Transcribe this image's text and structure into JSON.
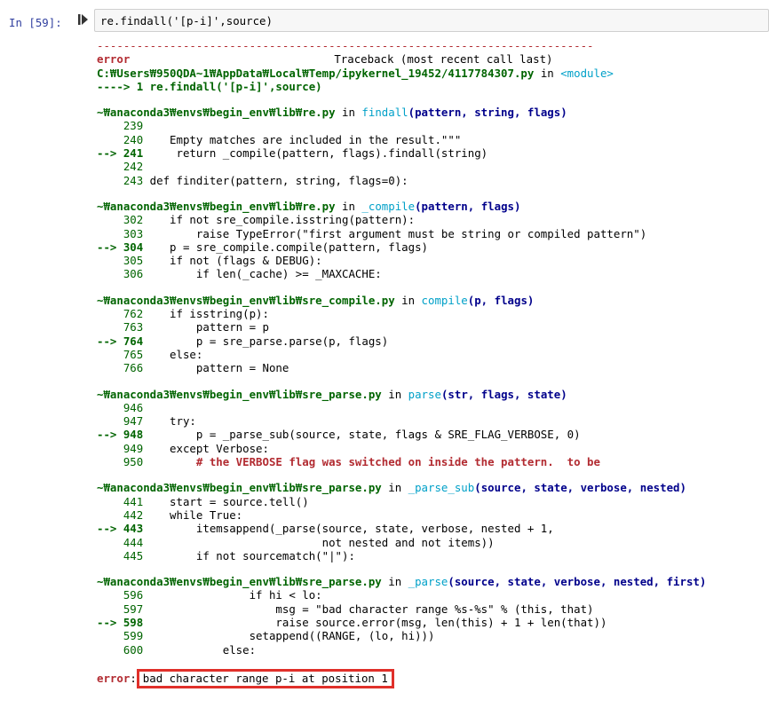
{
  "cell": {
    "prompt": "In [59]:",
    "code": "re.findall('[p-i]',source)"
  },
  "traceback": {
    "separator": "---------------------------------------------------------------------------",
    "error_name": "error",
    "header_right": "Traceback (most recent call last)",
    "frame0_path": "C:₩Users₩950QDA~1₩AppData₩Local₩Temp/ipykernel_19452/4117784307.py",
    "frame0_in": " in ",
    "frame0_module": "<module>",
    "frame0_line": "----> 1 re.findall('[p-i]',source)",
    "frames": [
      {
        "path": "~₩anaconda3₩envs₩begin_env₩lib₩re.py",
        "func": "findall",
        "sig": "(pattern, string, flags)",
        "lines": [
          {
            "no": "    239",
            "code": ""
          },
          {
            "no": "    240",
            "code": "    Empty matches are included in the result.\"\"\""
          },
          {
            "no": "--> 241",
            "code": "     return _compile(pattern, flags).findall(string)",
            "current": true
          },
          {
            "no": "    242",
            "code": ""
          },
          {
            "no": "    243",
            "code": " def finditer(pattern, string, flags=0):"
          }
        ]
      },
      {
        "path": "~₩anaconda3₩envs₩begin_env₩lib₩re.py",
        "func": "_compile",
        "sig": "(pattern, flags)",
        "lines": [
          {
            "no": "    302",
            "code": "    if not sre_compile.isstring(pattern):"
          },
          {
            "no": "    303",
            "code": "        raise TypeError(\"first argument must be string or compiled pattern\")"
          },
          {
            "no": "--> 304",
            "code": "    p = sre_compile.compile(pattern, flags)",
            "current": true
          },
          {
            "no": "    305",
            "code": "    if not (flags & DEBUG):"
          },
          {
            "no": "    306",
            "code": "        if len(_cache) >= _MAXCACHE:"
          }
        ]
      },
      {
        "path": "~₩anaconda3₩envs₩begin_env₩lib₩sre_compile.py",
        "func": "compile",
        "sig": "(p, flags)",
        "lines": [
          {
            "no": "    762",
            "code": "    if isstring(p):"
          },
          {
            "no": "    763",
            "code": "        pattern = p"
          },
          {
            "no": "--> 764",
            "code": "        p = sre_parse.parse(p, flags)",
            "current": true
          },
          {
            "no": "    765",
            "code": "    else:"
          },
          {
            "no": "    766",
            "code": "        pattern = None"
          }
        ]
      },
      {
        "path": "~₩anaconda3₩envs₩begin_env₩lib₩sre_parse.py",
        "func": "parse",
        "sig": "(str, flags, state)",
        "lines": [
          {
            "no": "    946",
            "code": ""
          },
          {
            "no": "    947",
            "code": "    try:"
          },
          {
            "no": "--> 948",
            "code": "        p = _parse_sub(source, state, flags & SRE_FLAG_VERBOSE, 0)",
            "current": true
          },
          {
            "no": "    949",
            "code": "    except Verbose:"
          },
          {
            "no": "    950",
            "code": "        # the VERBOSE flag was switched on inside the pattern.  to be"
          }
        ]
      },
      {
        "path": "~₩anaconda3₩envs₩begin_env₩lib₩sre_parse.py",
        "func": "_parse_sub",
        "sig": "(source, state, verbose, nested)",
        "lines": [
          {
            "no": "    441",
            "code": "    start = source.tell()"
          },
          {
            "no": "    442",
            "code": "    while True:"
          },
          {
            "no": "--> 443",
            "code": "        itemsappend(_parse(source, state, verbose, nested + 1,",
            "current": true
          },
          {
            "no": "    444",
            "code": "                           not nested and not items))"
          },
          {
            "no": "    445",
            "code": "        if not sourcematch(\"|\"):"
          }
        ]
      },
      {
        "path": "~₩anaconda3₩envs₩begin_env₩lib₩sre_parse.py",
        "func": "_parse",
        "sig": "(source, state, verbose, nested, first)",
        "lines": [
          {
            "no": "    596",
            "code": "                if hi < lo:"
          },
          {
            "no": "    597",
            "code": "                    msg = \"bad character range %s-%s\" % (this, that)"
          },
          {
            "no": "--> 598",
            "code": "                    raise source.error(msg, len(this) + 1 + len(that))",
            "current": true
          },
          {
            "no": "    599",
            "code": "                setappend((RANGE, (lo, hi)))"
          },
          {
            "no": "    600",
            "code": "            else:"
          }
        ]
      }
    ],
    "final_error_name": "error",
    "final_error_colon": ":",
    "final_error_message": "bad character range p-i at position 1"
  }
}
